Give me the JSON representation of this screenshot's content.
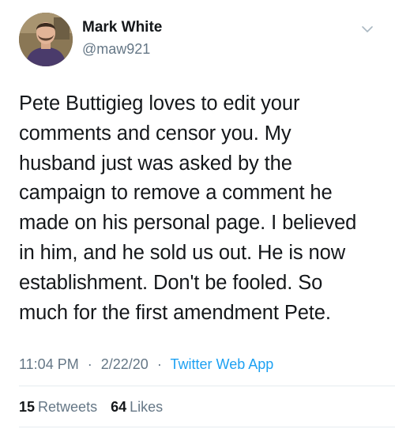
{
  "author": {
    "display_name": "Mark White",
    "handle": "@maw921",
    "avatar_icon": "profile-photo"
  },
  "menu_icon": "chevron-down-icon",
  "tweet": {
    "text": "Pete Buttigieg loves to edit your\ncomments and censor you. My\nhusband just was asked by the\ncampaign to remove a comment he\nmade on his personal page. I believed\nin him, and he sold us out. He is now\nestablishment. Don't be fooled. So\nmuch for the first amendment Pete."
  },
  "meta": {
    "time": "11:04 PM",
    "date": "2/22/20",
    "separator": "·",
    "source": "Twitter Web App"
  },
  "stats": {
    "retweets_count": "15",
    "retweets_label": "Retweets",
    "likes_count": "64",
    "likes_label": "Likes"
  },
  "colors": {
    "link": "#1da1f2",
    "secondary_text": "#657786",
    "primary_text": "#14171a",
    "divider": "#e6ecf0"
  }
}
